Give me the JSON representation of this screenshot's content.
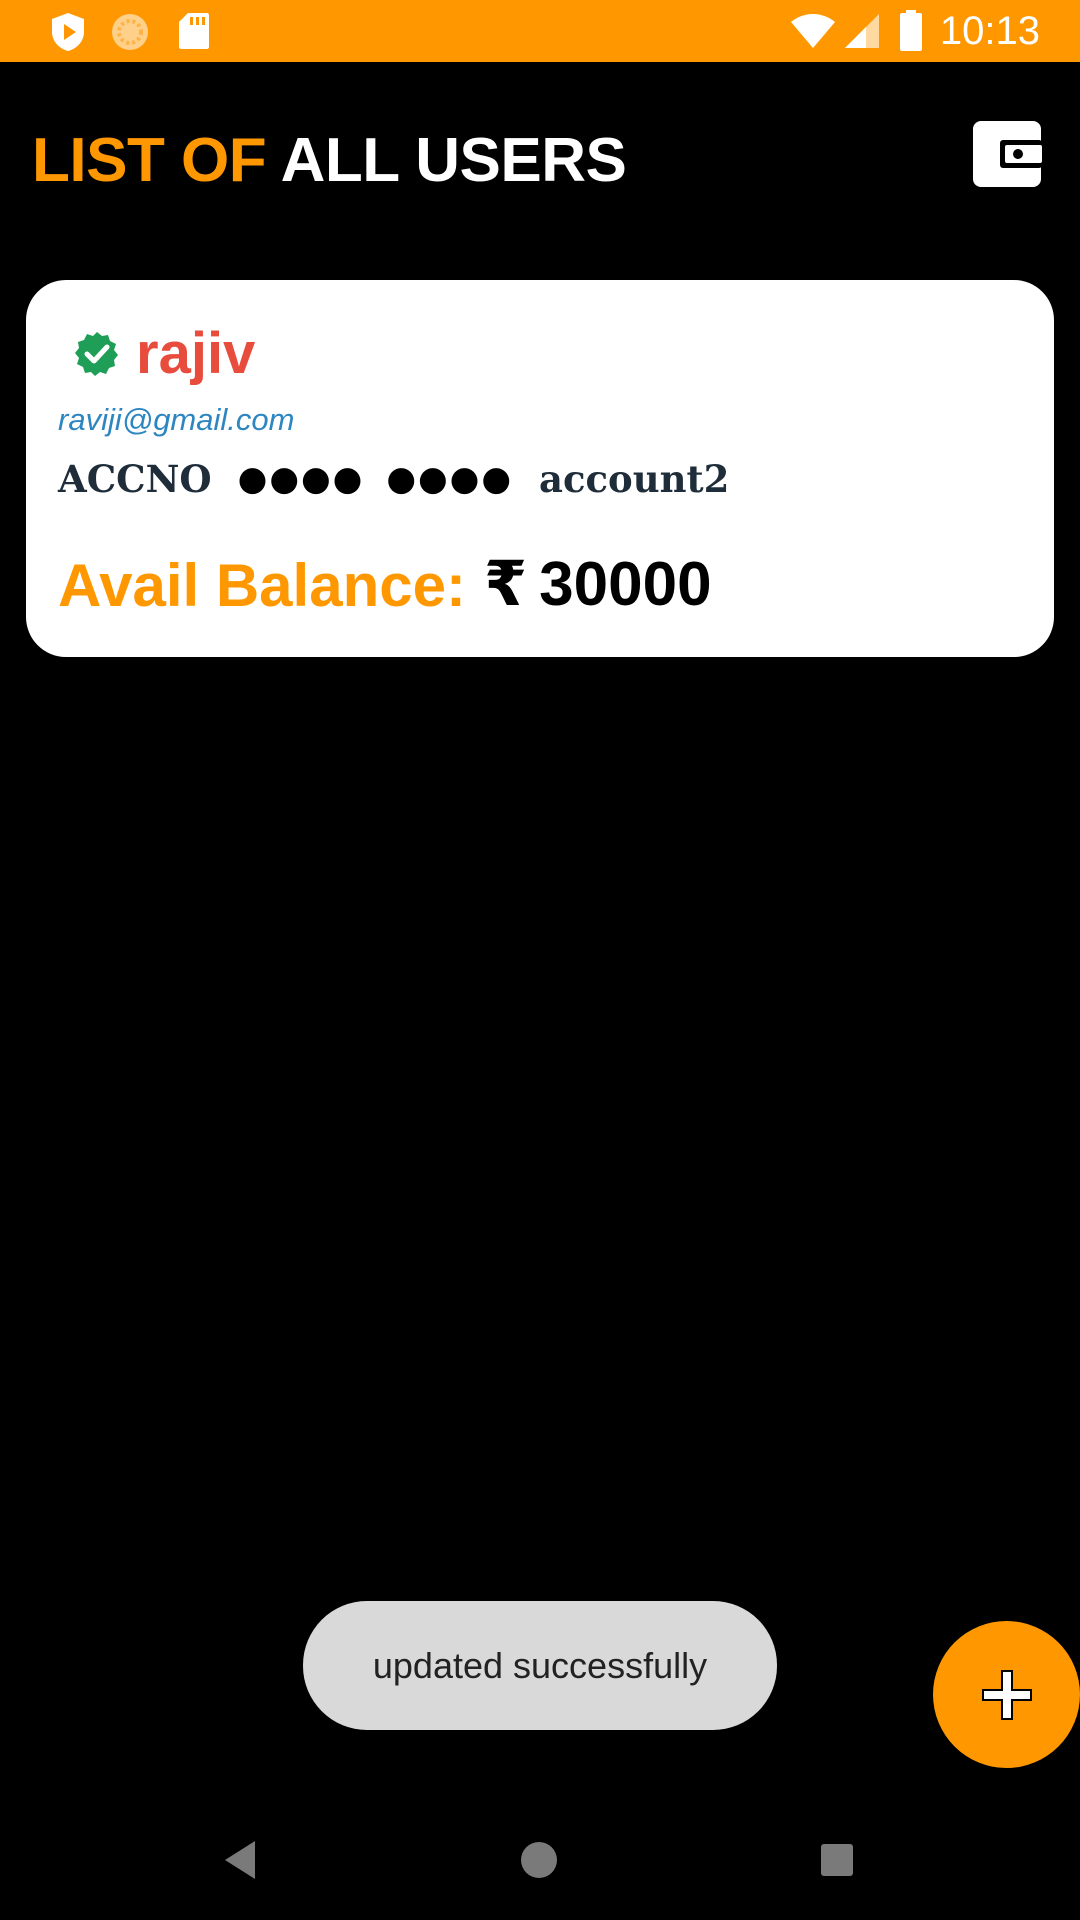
{
  "status_bar": {
    "time": "10:13",
    "icons": [
      "play-protect-icon",
      "sync-circle-icon",
      "sd-card-icon",
      "wifi-icon",
      "signal-icon",
      "battery-icon"
    ],
    "background": "#FF9800"
  },
  "header": {
    "title_part1": "LIST OF",
    "title_part2": "ALL USERS",
    "title_part1_color": "#FF9800",
    "title_part2_color": "#FFFFFF",
    "action_icon": "wallet-icon"
  },
  "users": [
    {
      "name": "rajiv",
      "verified": true,
      "email": "raviji@gmail.com",
      "acc_label": "ACCNO",
      "acc_mask_1": "●●●●",
      "acc_mask_2": "●●●●",
      "acc_id": "account2",
      "balance_label": "Avail Balance:",
      "currency": "₹",
      "balance": "30000"
    }
  ],
  "toast": {
    "message": "updated successfully"
  },
  "fab": {
    "icon": "plus-icon",
    "color": "#FF9800"
  },
  "nav_bar": {
    "buttons": [
      "back-icon",
      "home-icon",
      "recents-icon"
    ]
  }
}
